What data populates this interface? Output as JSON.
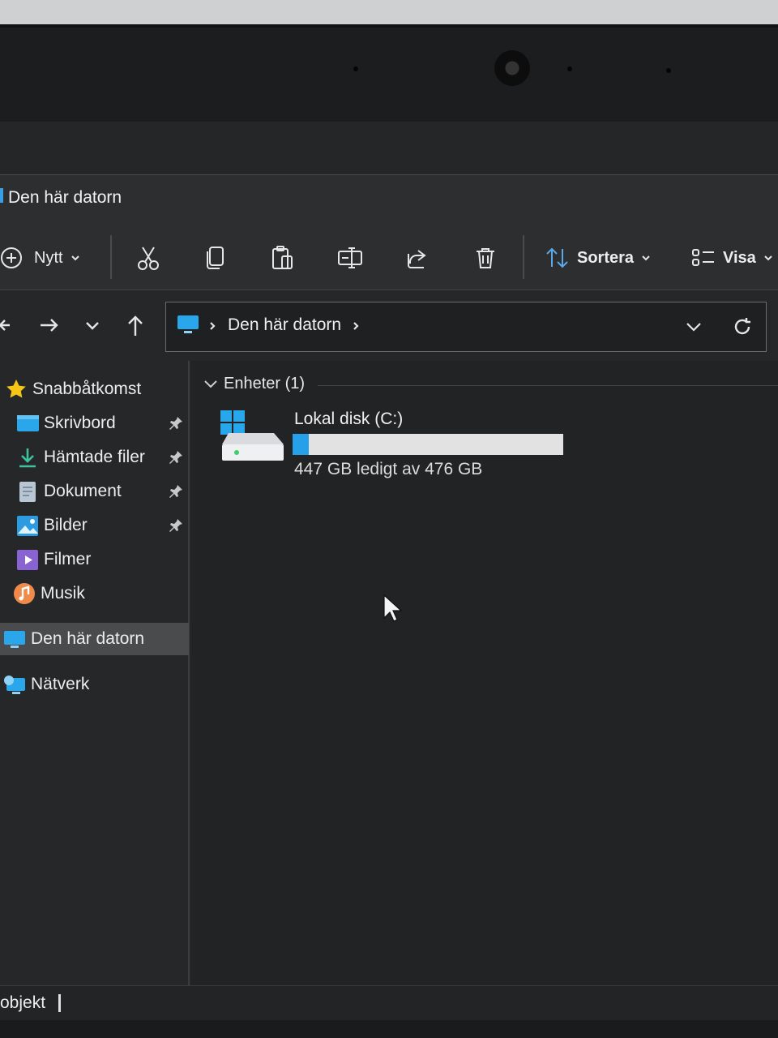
{
  "window": {
    "title": "Den här datorn"
  },
  "toolbar": {
    "new_label": "Nytt",
    "sort_label": "Sortera",
    "view_label": "Visa",
    "icons": [
      "plus-circle-icon",
      "cut-icon",
      "copy-icon",
      "paste-icon",
      "rename-icon",
      "share-icon",
      "delete-icon"
    ]
  },
  "address": {
    "path": "Den här datorn"
  },
  "sidebar": {
    "quick_access": "Snabbåtkomst",
    "items": [
      {
        "label": "Skrivbord",
        "pinned": true
      },
      {
        "label": "Hämtade filer",
        "pinned": true
      },
      {
        "label": "Dokument",
        "pinned": true
      },
      {
        "label": "Bilder",
        "pinned": true
      },
      {
        "label": "Filmer",
        "pinned": false
      },
      {
        "label": "Musik",
        "pinned": false
      }
    ],
    "this_pc": "Den här datorn",
    "network": "Nätverk"
  },
  "content": {
    "group_header": "Enheter (1)",
    "drive": {
      "name": "Lokal disk (C:)",
      "space_text": "447 GB ledigt av 476 GB",
      "used_fraction": 0.061
    }
  },
  "status": {
    "text": "objekt"
  },
  "colors": {
    "accent": "#26a0e8",
    "background": "#222325",
    "selected": "#4a4b4d"
  }
}
